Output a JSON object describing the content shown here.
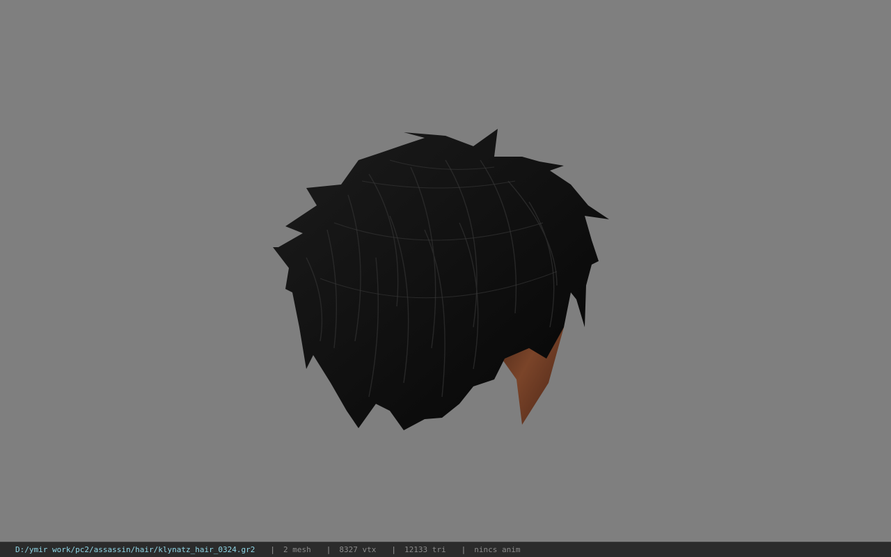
{
  "viewer": {
    "background_color": "#7f7f7f",
    "model": {
      "subject": "black spiky hair mesh",
      "hair_color": "#111111",
      "skin_color": "#6b3a26"
    }
  },
  "statusbar": {
    "file_path": "D:/ymir work/pc2/assassin/hair/klynatz_hair_0324.gr2",
    "separator": "|",
    "mesh_count": "2 mesh",
    "vertex_count": "8327 vtx",
    "triangle_count": "12133 tri",
    "anim_status": "nincs anim",
    "path_color": "#8fd6e6",
    "text_color": "#8a8a8a"
  }
}
